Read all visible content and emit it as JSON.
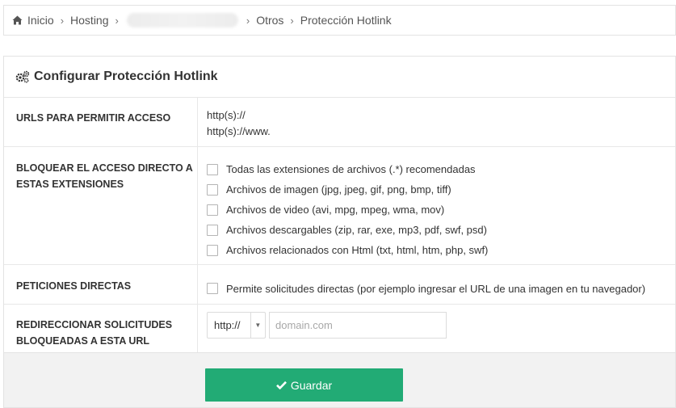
{
  "breadcrumb": {
    "home": "Inicio",
    "hosting": "Hosting",
    "otros": "Otros",
    "current": "Protección Hotlink"
  },
  "panel": {
    "title": "Configurar Protección Hotlink"
  },
  "urls": {
    "label": "URLS PARA PERMITIR ACCESO",
    "lines": [
      "http(s)://",
      "http(s)://www."
    ]
  },
  "block": {
    "label": "BLOQUEAR EL ACCESO DIRECTO A ESTAS EXTENSIONES",
    "options": [
      "Todas las extensiones de archivos (.*) recomendadas",
      "Archivos de imagen (jpg, jpeg, gif, png, bmp, tiff)",
      "Archivos de video (avi, mpg, mpeg, wma, mov)",
      "Archivos descargables (zip, rar, exe, mp3, pdf, swf, psd)",
      "Archivos relacionados con Html (txt, html, htm, php, swf)"
    ]
  },
  "direct": {
    "label": "PETICIONES DIRECTAS",
    "option": "Permite solicitudes directas (por ejemplo ingresar el URL de una imagen en tu navegador)"
  },
  "redirect": {
    "label": "REDIRECCIONAR SOLICITUDES BLOQUEADAS A ESTA URL",
    "protocol": "http://",
    "placeholder": "domain.com"
  },
  "actions": {
    "save_label": "Guardar"
  },
  "colors": {
    "save_button": "#22ab75"
  }
}
